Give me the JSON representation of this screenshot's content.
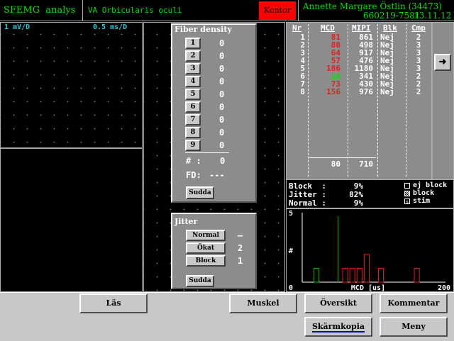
{
  "header": {
    "app_title": "SFEMG  analys",
    "muscle": "VA Orbicularis oculi",
    "mode_badge": "Kontor",
    "patient_name": "Annette Margare Östlin (34473)",
    "patient_id": "660219-7581",
    "date": "13.11.12"
  },
  "signal_panel": {
    "gain": "1 mV/D",
    "sweep": "0.5 ms/D"
  },
  "fiber_density": {
    "title": "Fiber density",
    "buttons": [
      "1",
      "2",
      "3",
      "4",
      "5",
      "6",
      "7",
      "8",
      "9"
    ],
    "values": [
      "0",
      "0",
      "0",
      "0",
      "0",
      "0",
      "0",
      "0",
      "0"
    ],
    "count_label": "# :",
    "count_value": "0",
    "fd_label": "FD:",
    "fd_value": "---",
    "clear_label": "Sudda"
  },
  "jitter_panel": {
    "title": "Jitter",
    "rows": [
      {
        "label": "Normal",
        "value": "–"
      },
      {
        "label": "Ökat",
        "value": "2"
      },
      {
        "label": "Block",
        "value": "1"
      }
    ],
    "clear_label": "Sudda"
  },
  "results_table": {
    "headers": [
      "Nr",
      "MCD",
      "MIPI",
      "Blk",
      "Cmp"
    ],
    "rows": [
      {
        "nr": "1",
        "mcd": "81",
        "mcd_color": "#e02020",
        "mipi": "861",
        "blk": "Nej",
        "cmp": "2"
      },
      {
        "nr": "2",
        "mcd": "80",
        "mcd_color": "#e02020",
        "mipi": "498",
        "blk": "Nej",
        "cmp": "3"
      },
      {
        "nr": "3",
        "mcd": "64",
        "mcd_color": "#e02020",
        "mipi": "917",
        "blk": "Nej",
        "cmp": "3"
      },
      {
        "nr": "4",
        "mcd": "57",
        "mcd_color": "#e02020",
        "mipi": "476",
        "blk": "Nej",
        "cmp": "3"
      },
      {
        "nr": "5",
        "mcd": "186",
        "mcd_color": "#e02020",
        "mipi": "1180",
        "blk": "Nej",
        "cmp": "3"
      },
      {
        "nr": "6",
        "mcd": "19",
        "mcd_color": "#00e000",
        "mipi": "341",
        "blk": "Nej",
        "cmp": "2"
      },
      {
        "nr": "7",
        "mcd": "73",
        "mcd_color": "#e02020",
        "mipi": "430",
        "blk": "Nej",
        "cmp": "2"
      },
      {
        "nr": "8",
        "mcd": "156",
        "mcd_color": "#e02020",
        "mipi": "976",
        "blk": "Nej",
        "cmp": "2"
      }
    ],
    "mean_mcd": "80",
    "mean_mipi": "710",
    "arrow_icon": "arrow-right-icon"
  },
  "summary": {
    "block_label": "Block  :",
    "block_value": "9%",
    "jitter_label": "Jitter :",
    "jitter_value": "82%",
    "normal_label": "Normal :",
    "normal_value": "9%",
    "legend": [
      {
        "label": "ej block",
        "icon": "empty-box-icon"
      },
      {
        "label": "block",
        "icon": "hatched-box-icon"
      },
      {
        "label": "stim",
        "icon": "s-box-icon"
      }
    ]
  },
  "chart_data": {
    "type": "bar",
    "xlabel": "MCD [us]",
    "ylabel": "#",
    "xlim": [
      0,
      200
    ],
    "ylim": [
      0,
      5
    ],
    "x_ticks": [
      "0",
      "200"
    ],
    "y_ticks": [
      "5"
    ],
    "reference_line_x": 50,
    "bins": [
      {
        "x": 20,
        "count": 1,
        "color": "#00c000"
      },
      {
        "x": 60,
        "count": 1,
        "color": "#e02020"
      },
      {
        "x": 70,
        "count": 1,
        "color": "#e02020"
      },
      {
        "x": 80,
        "count": 1,
        "color": "#e02020"
      },
      {
        "x": 90,
        "count": 2,
        "color": "#e02020"
      },
      {
        "x": 110,
        "count": 1,
        "color": "#e02020"
      },
      {
        "x": 160,
        "count": 1,
        "color": "#e02020"
      }
    ]
  },
  "footer": {
    "read_label": "Läs",
    "muscle_label": "Muskel",
    "overview_label": "Översikt",
    "comment_label": "Kommentar",
    "screenshot_label": "Skärmkopia",
    "menu_label": "Meny"
  }
}
